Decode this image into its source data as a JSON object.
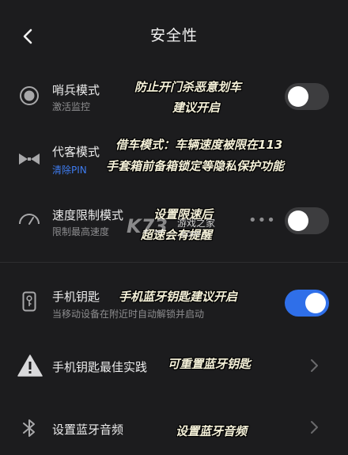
{
  "header": {
    "title": "安全性"
  },
  "rows": {
    "sentry": {
      "title": "哨兵模式",
      "subtitle": "激活监控",
      "toggle_on": false
    },
    "valet": {
      "title": "代客模式",
      "subtitle": "清除PIN"
    },
    "speed_limit": {
      "title": "速度限制模式",
      "subtitle": "限制最高速度",
      "toggle_on": false
    },
    "phone_key": {
      "title": "手机钥匙",
      "subtitle": "当移动设备在附近时自动解锁并启动",
      "toggle_on": true
    },
    "phone_key_best": {
      "title": "手机钥匙最佳实践"
    },
    "bluetooth_audio": {
      "title": "设置蓝牙音频"
    }
  },
  "annotations": {
    "sentry_line1": "防止开门杀恶意划车",
    "sentry_line2": "建议开启",
    "valet_line1": "借车模式：车辆速度被限在113",
    "valet_line2": "手套箱前备箱锁定等隐私保护功能",
    "speed_line1": "设置限速后",
    "speed_line2": "超速会有提醒",
    "phone_key": "手机蓝牙钥匙建议开启",
    "phone_key_best": "可重置蓝牙钥匙",
    "bluetooth_audio": "设置蓝牙音频"
  },
  "watermark": {
    "logo": "K73",
    "text1": "游戏之家",
    "text2": ".com"
  },
  "colors": {
    "background": "#1c1c1e",
    "accent": "#2f6fe9",
    "link": "#3e7cf0",
    "warning": "#ffd400"
  }
}
